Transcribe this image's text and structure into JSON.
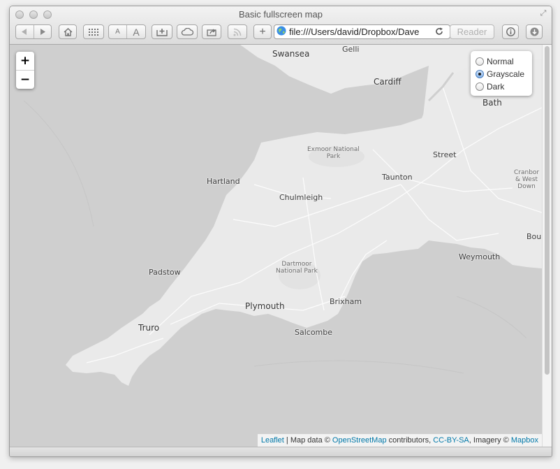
{
  "window": {
    "title": "Basic fullscreen map"
  },
  "toolbar": {
    "back_icon": "back-arrow-icon",
    "forward_icon": "forward-arrow-icon",
    "home_icon": "home-icon",
    "top_sites_icon": "grid-icon",
    "font_smaller_label": "A",
    "font_larger_label": "A",
    "add_bookmark_icon": "bookmark-add-icon",
    "cloud_icon": "cloud-icon",
    "share_icon": "share-icon",
    "rss_icon": "rss-icon",
    "new_tab_label": "+",
    "url": "file:///Users/david/Dropbox/Dave",
    "reader_label": "Reader",
    "info_icon": "info-icon",
    "downloads_icon": "download-icon"
  },
  "map": {
    "zoom_in_label": "+",
    "zoom_out_label": "−",
    "layers": [
      {
        "label": "Normal",
        "checked": false
      },
      {
        "label": "Grayscale",
        "checked": true
      },
      {
        "label": "Dark",
        "checked": false
      }
    ],
    "labels": {
      "swansea": "Swansea",
      "gelli": "Gelli",
      "cardiff": "Cardiff",
      "bath": "Bath",
      "exmoor_line1": "Exmoor National",
      "exmoor_line2": "Park",
      "street": "Street",
      "cranbor_line1": "Cranbor",
      "cranbor_line2": "& West",
      "cranbor_line3": "Down",
      "hartland": "Hartland",
      "taunton": "Taunton",
      "chulmleigh": "Chulmleigh",
      "bou": "Bou",
      "weymouth": "Weymouth",
      "dartmoor_line1": "Dartmoor",
      "dartmoor_line2": "National Park",
      "padstow": "Padstow",
      "plymouth": "Plymouth",
      "brixham": "Brixham",
      "truro": "Truro",
      "salcombe": "Salcombe"
    },
    "attribution": {
      "leaflet": "Leaflet",
      "sep1": " | Map data © ",
      "osm": "OpenStreetMap",
      "sep2": " contributors, ",
      "license": "CC-BY-SA",
      "sep3": ", Imagery © ",
      "mapbox": "Mapbox"
    }
  }
}
